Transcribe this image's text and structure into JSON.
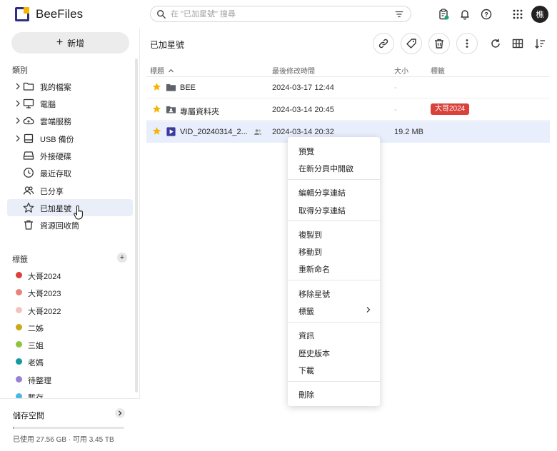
{
  "app": {
    "title": "BeeFiles",
    "avatar_initial": "樵"
  },
  "search": {
    "placeholder": "在 \"已加星號\" 搜尋"
  },
  "sidebar": {
    "new_button": "新增",
    "categories_label": "類別",
    "nav_items": [
      {
        "label": "我的檔案",
        "icon": "folder-icon",
        "expandable": true
      },
      {
        "label": "電腦",
        "icon": "computer-icon",
        "expandable": true
      },
      {
        "label": "雲端服務",
        "icon": "cloud-icon",
        "expandable": true
      },
      {
        "label": "USB 備份",
        "icon": "usb-drive-icon",
        "expandable": true
      },
      {
        "label": "外接硬碟",
        "icon": "hard-drive-icon",
        "expandable": false
      },
      {
        "label": "最近存取",
        "icon": "clock-icon",
        "expandable": false
      },
      {
        "label": "已分享",
        "icon": "people-icon",
        "expandable": false
      },
      {
        "label": "已加星號",
        "icon": "star-icon",
        "expandable": false,
        "active": true
      },
      {
        "label": "資源回收筒",
        "icon": "trash-icon",
        "expandable": false
      }
    ],
    "tags_label": "標籤",
    "tags": [
      {
        "label": "大哥2024",
        "color": "#d9413a"
      },
      {
        "label": "大哥2023",
        "color": "#e8837c"
      },
      {
        "label": "大哥2022",
        "color": "#f4c2bf"
      },
      {
        "label": "二姊",
        "color": "#c9a81a"
      },
      {
        "label": "三姐",
        "color": "#8cc63f"
      },
      {
        "label": "老媽",
        "color": "#16999f"
      },
      {
        "label": "待整理",
        "color": "#9b7fd6"
      },
      {
        "label": "暫存",
        "color": "#47b9e8"
      }
    ],
    "storage": {
      "title": "儲存空間",
      "used_fraction": 0.008,
      "summary": "已使用 27.56 GB · 可用 3.45 TB"
    }
  },
  "main": {
    "title": "已加星號",
    "columns": {
      "name": "標題",
      "modified": "最後修改時間",
      "size": "大小",
      "tags": "標籤"
    },
    "rows": [
      {
        "name": "BEE",
        "icon": "folder-icon",
        "modified": "2024-03-17 12:44",
        "size": "-",
        "tag": ""
      },
      {
        "name": "專屬資料夾",
        "icon": "shared-folder-icon",
        "modified": "2024-03-14 20:45",
        "size": "-",
        "tag": "大哥2024"
      },
      {
        "name": "VID_20240314_2...",
        "icon": "video-icon",
        "modified": "2024-03-14 20:32",
        "size": "19.2 MB",
        "tag": "",
        "selected": true,
        "shared": true
      }
    ]
  },
  "context_menu": {
    "items": [
      "預覽",
      "在新分頁中開啟",
      "編輯分享連結",
      "取得分享連結",
      "複製到",
      "移動到",
      "重新命名",
      "移除星號",
      "標籤",
      "資訊",
      "歷史版本",
      "下載",
      "刪除"
    ]
  },
  "colors": {
    "accent": "#2b2f86",
    "selection": "#e8eefb",
    "star": "#f4b400",
    "badge": "#d9413a"
  }
}
